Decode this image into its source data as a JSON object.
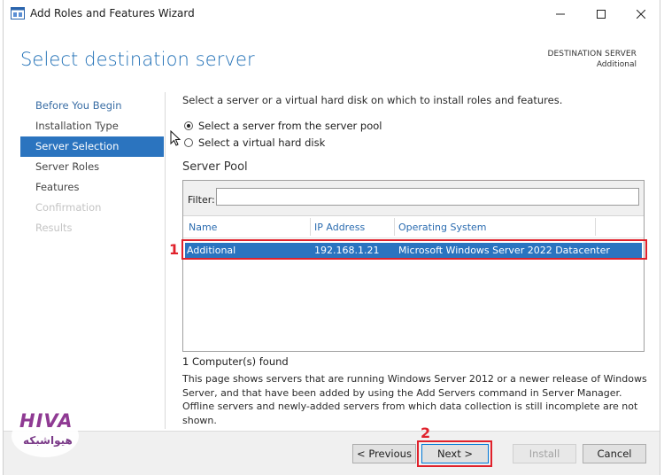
{
  "window": {
    "title": "Add Roles and Features Wizard"
  },
  "header": {
    "page_title": "Select destination server",
    "destination_label": "DESTINATION SERVER",
    "destination_value": "Additional"
  },
  "nav": {
    "items": [
      {
        "label": "Before You Begin",
        "state": "link"
      },
      {
        "label": "Installation Type",
        "state": "normal"
      },
      {
        "label": "Server Selection",
        "state": "active"
      },
      {
        "label": "Server Roles",
        "state": "normal"
      },
      {
        "label": "Features",
        "state": "normal"
      },
      {
        "label": "Confirmation",
        "state": "disabled"
      },
      {
        "label": "Results",
        "state": "disabled"
      }
    ]
  },
  "content": {
    "intro": "Select a server or a virtual hard disk on which to install roles and features.",
    "radio_options": [
      {
        "label": "Select a server from the server pool",
        "checked": true
      },
      {
        "label": "Select a virtual hard disk",
        "checked": false
      }
    ],
    "pool_title": "Server Pool",
    "filter_label": "Filter:",
    "filter_value": "",
    "columns": [
      "Name",
      "IP Address",
      "Operating System"
    ],
    "rows": [
      {
        "name": "Additional",
        "ip": "192.168.1.21",
        "os": "Microsoft Windows Server 2022 Datacenter",
        "selected": true
      }
    ],
    "found": "1 Computer(s) found",
    "info": "This page shows servers that are running Windows Server 2012 or a newer release of Windows Server, and that have been added by using the Add Servers command in Server Manager. Offline servers and newly-added servers from which data collection is still incomplete are not shown."
  },
  "annotations": {
    "marker_1": "1",
    "marker_2": "2",
    "color": "#e0212b"
  },
  "buttons": {
    "previous": "< Previous",
    "next": "Next >",
    "install": "Install",
    "cancel": "Cancel"
  },
  "logo": {
    "word": "HIVA",
    "sub": "هیواشبکه"
  },
  "colors": {
    "accent": "#2b74bf",
    "title_blue": "#1f6fb6",
    "highlight_red": "#e0212b",
    "logo_purple": "#8f3a93"
  }
}
